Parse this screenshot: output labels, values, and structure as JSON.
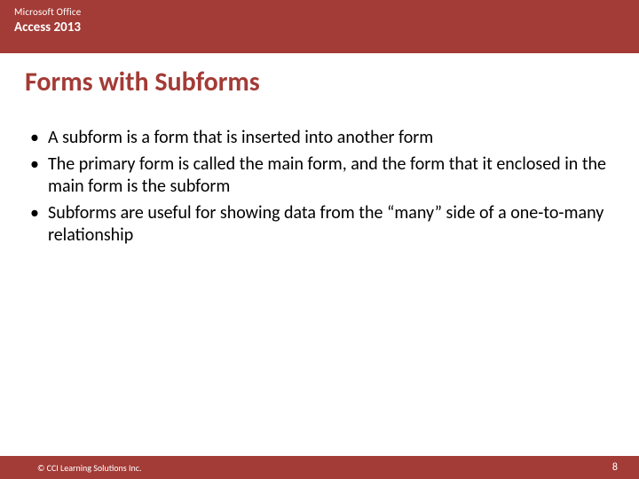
{
  "header": {
    "brand_line1": "Microsoft Office",
    "brand_line2": "Access 2013"
  },
  "title": "Forms with Subforms",
  "bullets": [
    "A subform is a form that is inserted into another form",
    "The primary form is called the main form, and the form that it enclosed in the main form is the subform",
    "Subforms are useful for showing data from the “many” side of a one-to-many relationship"
  ],
  "footer": {
    "copyright": "© CCI Learning Solutions Inc.",
    "page_number": "8"
  }
}
